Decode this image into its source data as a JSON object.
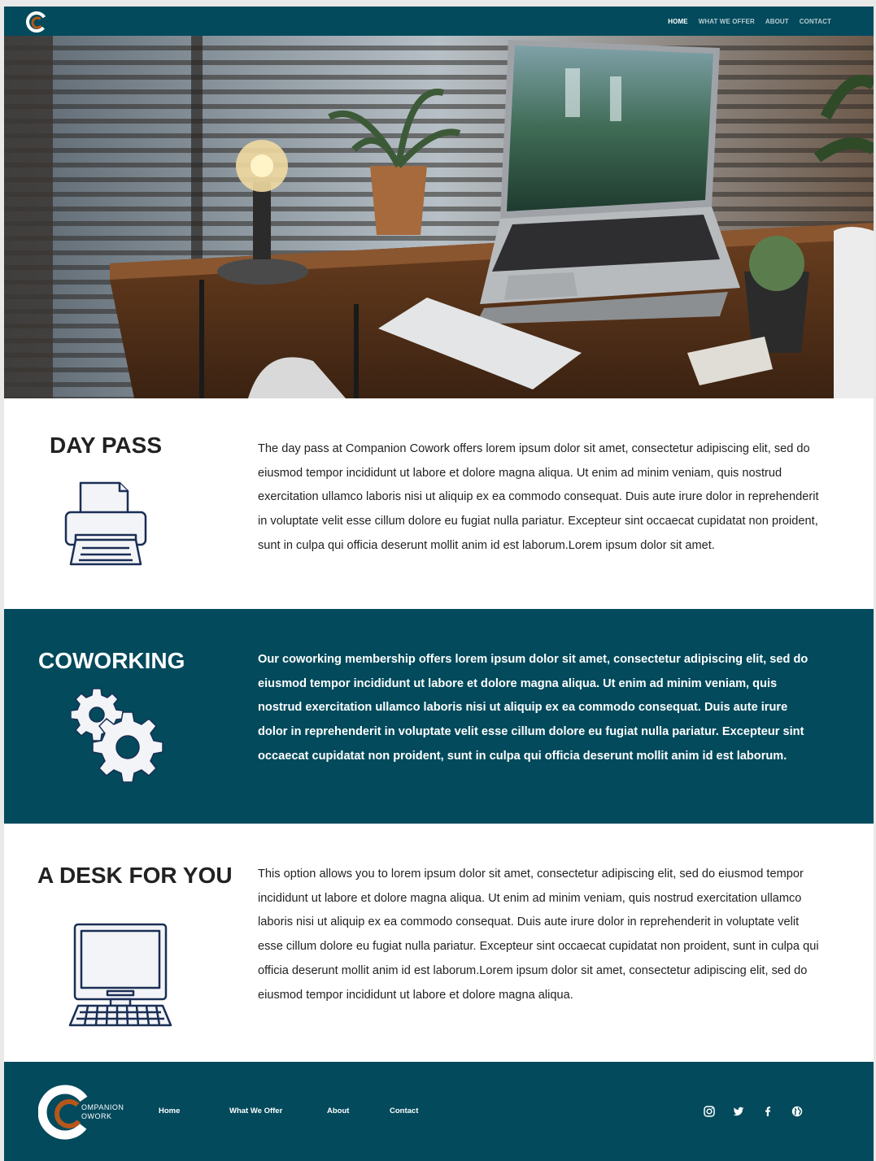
{
  "nav": {
    "logo_icon": "companion-cowork-c-logo",
    "links": [
      {
        "label": "HOME",
        "active": true
      },
      {
        "label": "WHAT WE OFFER",
        "active": false
      },
      {
        "label": "ABOUT",
        "active": false
      },
      {
        "label": "CONTACT",
        "active": false
      }
    ]
  },
  "hero": {
    "image": "desk-with-laptop-lamp-plants-photo"
  },
  "sections": [
    {
      "title": "DAY PASS",
      "icon": "printer-icon",
      "text": "The day pass at Companion Cowork offers lorem ipsum dolor sit amet, consectetur adipiscing elit, sed do eiusmod tempor incididunt ut labore et dolore magna aliqua. Ut enim ad minim veniam, quis nostrud exercitation ullamco laboris nisi ut aliquip ex ea commodo consequat. Duis aute irure dolor in reprehenderit in voluptate velit esse cillum dolore eu fugiat nulla pariatur. Excepteur sint occaecat cupidatat non proident, sunt in culpa qui officia deserunt mollit anim id est laborum.Lorem ipsum dolor sit amet."
    },
    {
      "title": "COWORKING",
      "icon": "gears-icon",
      "text": "Our coworking membership offers lorem ipsum dolor sit amet, consectetur adipiscing elit, sed do eiusmod tempor incididunt ut labore et dolore magna aliqua. Ut enim ad minim veniam, quis nostrud exercitation ullamco laboris nisi ut aliquip ex ea commodo consequat. Duis aute irure dolor in reprehenderit in voluptate velit esse cillum dolore eu fugiat nulla pariatur. Excepteur sint occaecat cupidatat non proident, sunt in culpa qui officia deserunt mollit anim id est laborum."
    },
    {
      "title": "A DESK FOR YOU",
      "icon": "desktop-computer-icon",
      "text": "This option allows you to lorem ipsum dolor sit amet, consectetur adipiscing elit, sed do eiusmod tempor incididunt ut labore et dolore magna aliqua. Ut enim ad minim veniam, quis nostrud exercitation ullamco laboris nisi ut aliquip ex ea commodo consequat. Duis aute irure dolor in reprehenderit in voluptate velit esse cillum dolore eu fugiat nulla pariatur. Excepteur sint occaecat cupidatat non proident, sunt in culpa qui officia deserunt mollit anim id est laborum.Lorem ipsum dolor sit amet, consectetur adipiscing elit, sed do eiusmod tempor incididunt ut labore et dolore magna aliqua."
    }
  ],
  "footer": {
    "brand_line1": "OMPANION",
    "brand_line2": "OWORK",
    "links": [
      "Home",
      "What We Offer",
      "About",
      "Contact"
    ],
    "social_icons": [
      "instagram-icon",
      "twitter-icon",
      "facebook-icon",
      "globe-icon"
    ]
  },
  "colors": {
    "primary": "#024a5c",
    "accent": "#b5571c",
    "icon_stroke": "#1a2e55",
    "text": "#222222"
  }
}
